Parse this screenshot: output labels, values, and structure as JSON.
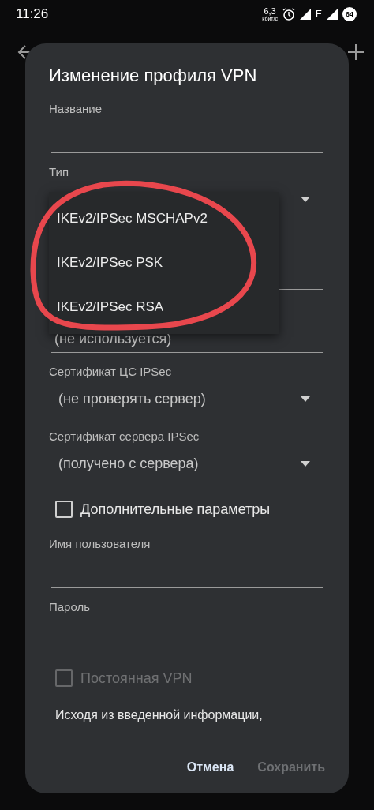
{
  "status_bar": {
    "time": "11:26",
    "speed": "6,3",
    "speed_unit": "кбит/с",
    "network": "E",
    "battery": "64"
  },
  "dialog": {
    "title": "Изменение профиля VPN",
    "fields": [
      {
        "kind": "text",
        "label": "Название"
      },
      {
        "kind": "spinner",
        "label": "Тип"
      },
      {
        "kind": "hidden"
      },
      {
        "kind": "text",
        "value": "(не используется)"
      },
      {
        "kind": "spinner",
        "label": "Сертификат ЦС IPSec",
        "value": "(не проверять сервер)"
      },
      {
        "kind": "spinner",
        "label": "Сертификат сервера IPSec",
        "value": "(получено с сервера)"
      },
      {
        "kind": "checkbox",
        "label": "Дополнительные параметры",
        "checked": false,
        "disabled": false
      },
      {
        "kind": "text",
        "label": "Имя пользователя"
      },
      {
        "kind": "text",
        "label": "Пароль"
      },
      {
        "kind": "checkbox",
        "label": "Постоянная VPN",
        "checked": false,
        "disabled": true
      },
      {
        "kind": "note",
        "text": "Исходя из введенной информации,"
      }
    ],
    "buttons": [
      {
        "label": "Отмена",
        "disabled": false
      },
      {
        "label": "Сохранить",
        "disabled": true
      }
    ]
  },
  "type_menu": {
    "options": [
      {
        "label": "IKEv2/IPSec MSCHAPv2"
      },
      {
        "label": "IKEv2/IPSec PSK"
      },
      {
        "label": "IKEv2/IPSec RSA"
      }
    ]
  }
}
